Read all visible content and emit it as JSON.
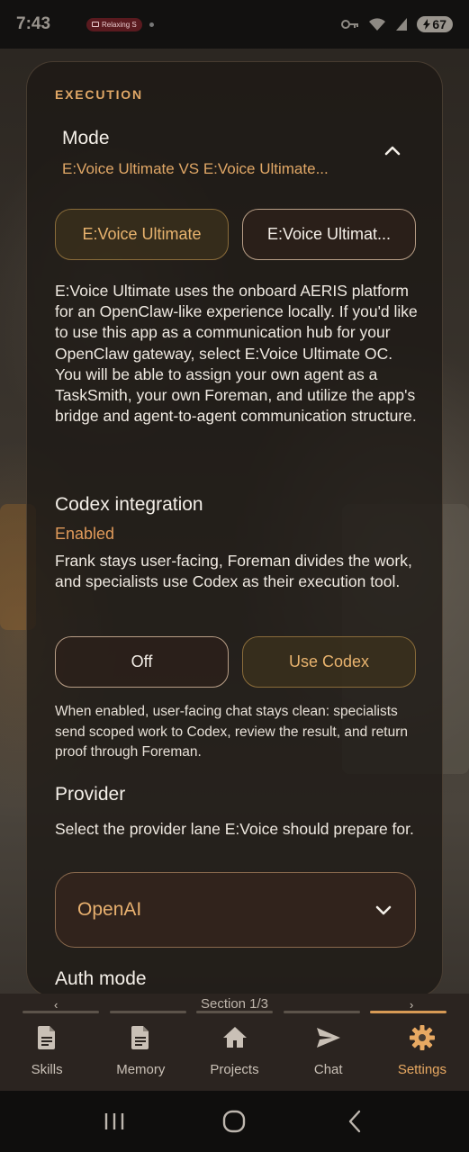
{
  "status_bar": {
    "time": "7:43",
    "notification": "Relaxing S",
    "battery": "67"
  },
  "execution": {
    "section_label": "EXECUTION",
    "mode": {
      "title": "Mode",
      "subtitle": "E:Voice Ultimate VS E:Voice Ultimate...",
      "option_1": "E:Voice Ultimate",
      "option_2": "E:Voice Ultimat...",
      "selected": "E:Voice Ultimate",
      "description": "E:Voice Ultimate uses the onboard AERIS platform for an OpenClaw-like experience locally. If you'd like to use this app as a communication hub for your OpenClaw gateway, select E:Voice Ultimate OC. You will be able to assign your own agent as a TaskSmith, your own Foreman, and utilize the app's bridge and agent-to-agent communication structure."
    },
    "codex": {
      "title": "Codex integration",
      "status": "Enabled",
      "description": "Frank stays user-facing, Foreman divides the work, and specialists use Codex as their execution tool.",
      "off_label": "Off",
      "use_label": "Use Codex",
      "selected": "Use Codex",
      "note": "When enabled, user-facing chat stays clean: specialists send scoped work to Codex, review the result, and return proof through Foreman."
    },
    "provider": {
      "title": "Provider",
      "description": "Select the provider lane E:Voice should prepare for.",
      "selected": "OpenAI"
    },
    "auth_mode": {
      "title": "Auth mode"
    }
  },
  "pager": {
    "label": "Section 1/3",
    "prev": "‹",
    "next": "›"
  },
  "nav": {
    "items": [
      {
        "label": "Skills",
        "icon": "document-icon"
      },
      {
        "label": "Memory",
        "icon": "document-icon"
      },
      {
        "label": "Projects",
        "icon": "home-icon"
      },
      {
        "label": "Chat",
        "icon": "send-icon"
      },
      {
        "label": "Settings",
        "icon": "gear-icon"
      }
    ],
    "active": "Settings"
  },
  "colors": {
    "accent": "#e0a766",
    "card_bg": "#1c1815",
    "nav_bg": "#2b2420"
  }
}
